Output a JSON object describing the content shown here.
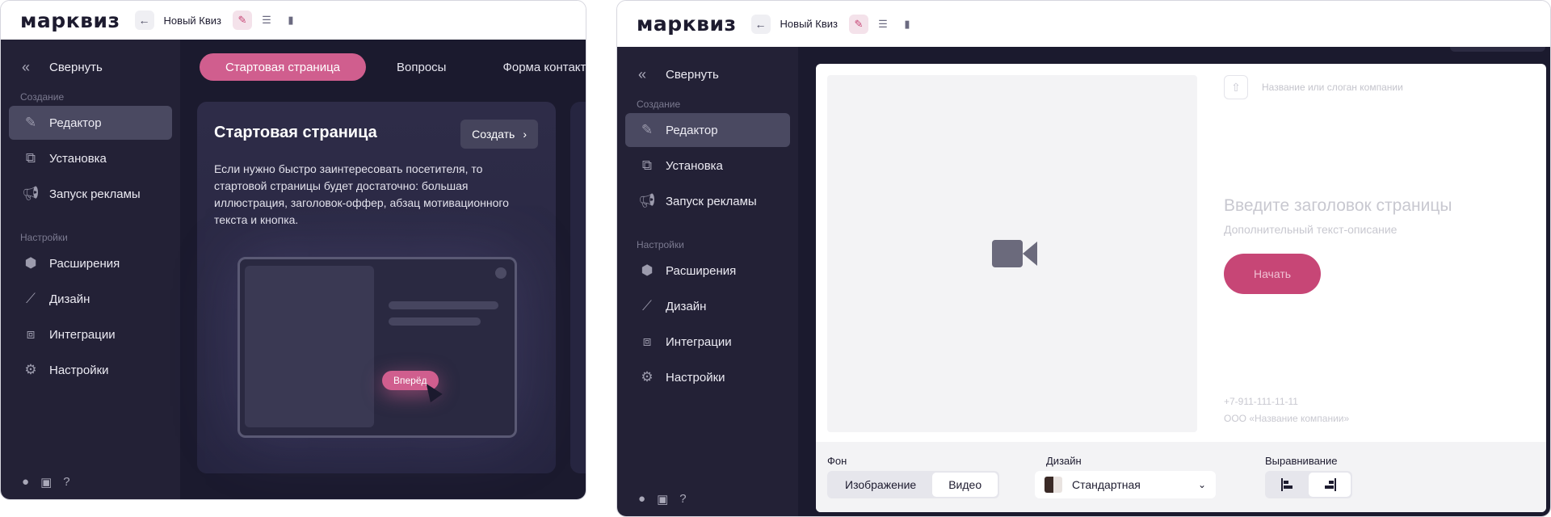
{
  "topbar": {
    "logo": "марквиз",
    "quiz_title": "Новый Квиз"
  },
  "sidebar": {
    "collapse": "Свернуть",
    "section_create": "Создание",
    "section_settings": "Настройки",
    "items": [
      {
        "label": "Редактор",
        "icon": "pencil-icon"
      },
      {
        "label": "Установка",
        "icon": "install-icon"
      },
      {
        "label": "Запуск рекламы",
        "icon": "megaphone-icon"
      },
      {
        "label": "Расширения",
        "icon": "puzzle-tag-icon"
      },
      {
        "label": "Дизайн",
        "icon": "brush-icon"
      },
      {
        "label": "Интеграции",
        "icon": "integrations-icon"
      },
      {
        "label": "Настройки",
        "icon": "gear-icon"
      }
    ]
  },
  "left": {
    "tabs": [
      "Стартовая страница",
      "Вопросы",
      "Форма контактов"
    ],
    "card": {
      "title": "Стартовая страница",
      "create_button": "Создать",
      "text": "Если нужно быстро заинтересовать посетителя, то стартовой страницы будет достаточно: большая иллюстрация, заголовок-оффер, абзац мотивационного текста и кнопка.",
      "mock_button": "Вперёд"
    }
  },
  "right": {
    "slogan_placeholder": "Название или слоган компании",
    "heading_placeholder": "Введите заголовок страницы",
    "subtext_placeholder": "Дополнительный текст-описание",
    "start_button": "Начать",
    "phone": "+7-911-111-11-11",
    "company": "ООО «Название компании»",
    "footer": {
      "bg_label": "Фон",
      "bg_options": [
        "Изображение",
        "Видео"
      ],
      "bg_selected": "Видео",
      "design_label": "Дизайн",
      "design_value": "Стандартная",
      "align_label": "Выравнивание",
      "align_selected": "right"
    }
  },
  "colors": {
    "accent": "#d05e8e",
    "sidebar_bg": "#232136",
    "main_bg": "#1b1a2e"
  }
}
